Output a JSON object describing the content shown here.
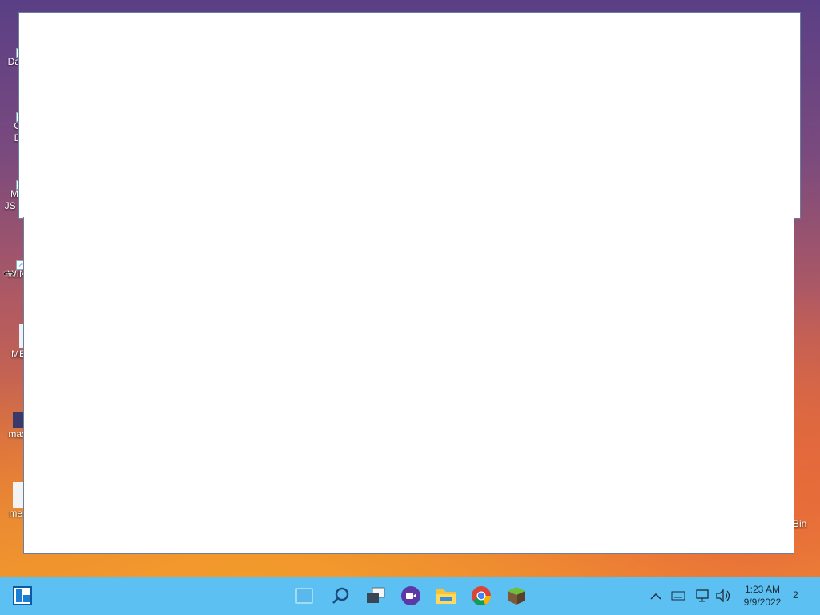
{
  "desktop": {
    "icons": [
      {
        "label": "Dat",
        "name": "desktop-icon-dat"
      },
      {
        "label": "O\nD",
        "name": "desktop-icon-o"
      },
      {
        "label": "ME\nJS Co",
        "name": "desktop-icon-me-js"
      },
      {
        "label": "WIN",
        "name": "desktop-icon-win"
      },
      {
        "label": "ME",
        "name": "desktop-icon-me"
      },
      {
        "label": "maxi",
        "name": "desktop-icon-maxi"
      },
      {
        "label": "men",
        "name": "desktop-icon-men"
      }
    ],
    "bin_label": "Bin"
  },
  "taskbar": {
    "pinned": [
      "start-icon",
      "search-icon",
      "task-view-icon",
      "meet-icon",
      "file-explorer-icon",
      "chrome-icon",
      "minecraft-icon"
    ],
    "clock_time": "1:23 AM",
    "clock_date": "9/9/2022",
    "notification_count": "2"
  },
  "colors": {
    "taskbar": "#5cc1f2",
    "window": "#ffffff"
  }
}
